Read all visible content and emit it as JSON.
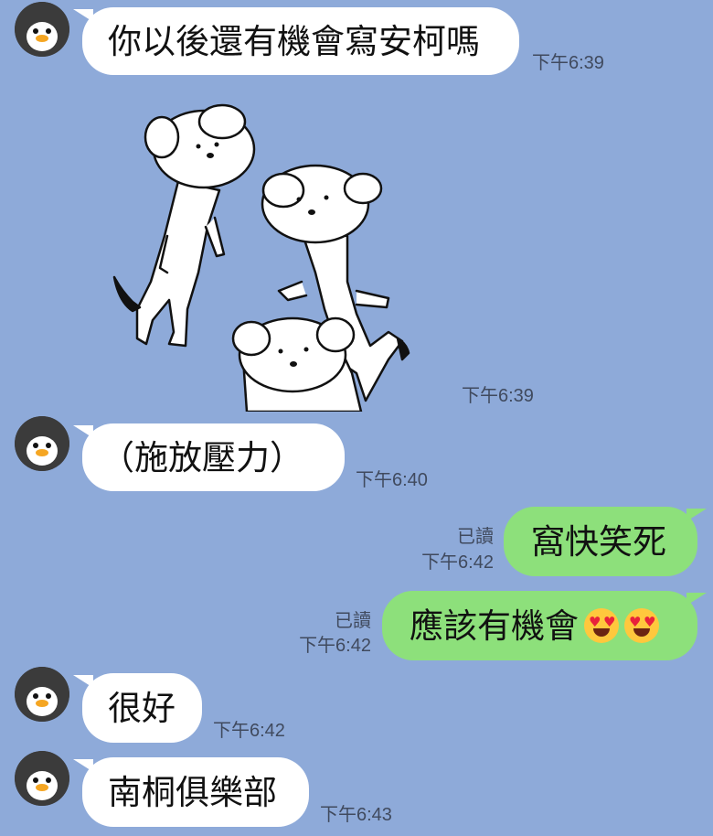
{
  "colors": {
    "background": "#8eaad9",
    "incoming_bubble": "#ffffff",
    "outgoing_bubble": "#8de07b",
    "meta_text": "#404a5e"
  },
  "messages": [
    {
      "direction": "in",
      "text": "你以後還有機會寫安柯嗎",
      "time": "下午6:39"
    },
    {
      "direction": "in",
      "type": "sticker",
      "sticker_icon": "white-dogs-sticker",
      "time": "下午6:39"
    },
    {
      "direction": "in",
      "text": "（施放壓力）",
      "time": "下午6:40"
    },
    {
      "direction": "out",
      "text": "窩快笑死",
      "read": "已讀",
      "time": "下午6:42"
    },
    {
      "direction": "out",
      "text": "應該有機會",
      "emoji": [
        "heart-eyes-emoji",
        "heart-eyes-emoji"
      ],
      "read": "已讀",
      "time": "下午6:42"
    },
    {
      "direction": "in",
      "text": "很好",
      "time": "下午6:42"
    },
    {
      "direction": "in",
      "text": "南桐俱樂部",
      "time": "下午6:43"
    }
  ],
  "avatar_icon": "penguin-avatar-icon"
}
